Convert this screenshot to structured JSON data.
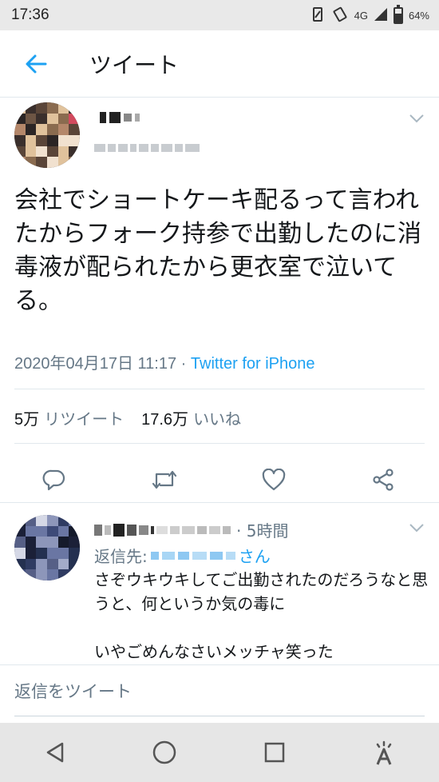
{
  "status_bar": {
    "time": "17:36",
    "network": "4G",
    "battery": "64%",
    "battery_level": 0.64
  },
  "header": {
    "title": "ツイート",
    "back_icon": "arrow-left-icon"
  },
  "tweet": {
    "text": "会社でショートケーキ配るって言われたからフォーク持参で出勤したのに消毒液が配られたから更衣室で泣いてる。",
    "timestamp": "2020年04月17日 11:17",
    "separator": " · ",
    "client": "Twitter for iPhone",
    "retweets_count": "5万",
    "retweets_label": "リツイート",
    "likes_count": "17.6万",
    "likes_label": "いいね"
  },
  "actions": [
    "reply-icon",
    "retweet-icon",
    "like-icon",
    "share-icon"
  ],
  "reply": {
    "time": "· 5時間",
    "reply_to_prefix": "返信先:",
    "reply_to_suffix": "さん",
    "text": "さぞウキウキしてご出勤されたのだろうなと思うと、何というか気の毒に\n\nいやごめんなさいメッチャ笑った"
  },
  "composer": {
    "placeholder": "返信をツイート"
  },
  "colors": {
    "accent": "#1da1f2",
    "secondary_text": "#657786",
    "divider": "#e1e8ed"
  }
}
